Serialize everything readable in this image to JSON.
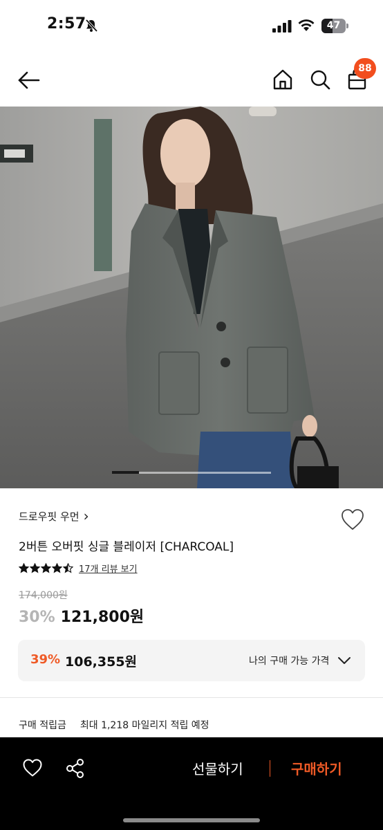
{
  "status": {
    "time": "2:57",
    "battery_percent": "47",
    "battery_level": 0.47
  },
  "nav": {
    "cart_count": "88",
    "icons": [
      "back-arrow-icon",
      "home-icon",
      "search-icon",
      "shopping-bag-icon"
    ]
  },
  "gallery": {
    "current_page": 1,
    "progress_fraction": 0.17
  },
  "product": {
    "brand": "드로우핏 우먼",
    "brand_chevron": "›",
    "name": "2버튼 오버핏 싱글 블레이저 [CHARCOAL]",
    "rating_stars": 4.5,
    "review_link": "17개 리뷰 보기",
    "original_price": "174,000원",
    "discount": "30%",
    "price": "121,800원"
  },
  "member_price": {
    "discount": "39%",
    "price": "106,355원",
    "label": "나의 구매 가능 가격"
  },
  "points": {
    "label": "구매 적립금",
    "value": "최대 1,218 마일리지 적립 예정"
  },
  "actions": {
    "gift_label": "선물하기",
    "buy_label": "구매하기"
  },
  "colors": {
    "accent": "#ef5a26",
    "badge": "#f24e1e",
    "bottom_bar": "#000000"
  }
}
